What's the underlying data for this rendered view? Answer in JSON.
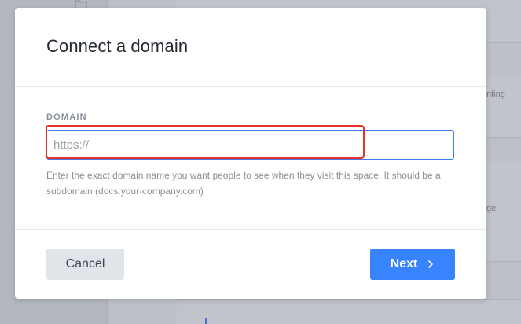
{
  "background": {
    "snippet_1": "nting",
    "snippet_2": "ge."
  },
  "modal": {
    "title": "Connect a domain",
    "field_label": "DOMAIN",
    "input": {
      "value": "",
      "placeholder": "https://"
    },
    "help_text": "Enter the exact domain name you want people to see when they visit this space. It should be a subdomain (docs.your-company.com)",
    "cancel_label": "Cancel",
    "next_label": "Next",
    "next_icon": "chevron-right-icon"
  },
  "colors": {
    "primary": "#3884ff",
    "highlight": "#e5332a",
    "cancel_bg": "#e1e5ea"
  }
}
